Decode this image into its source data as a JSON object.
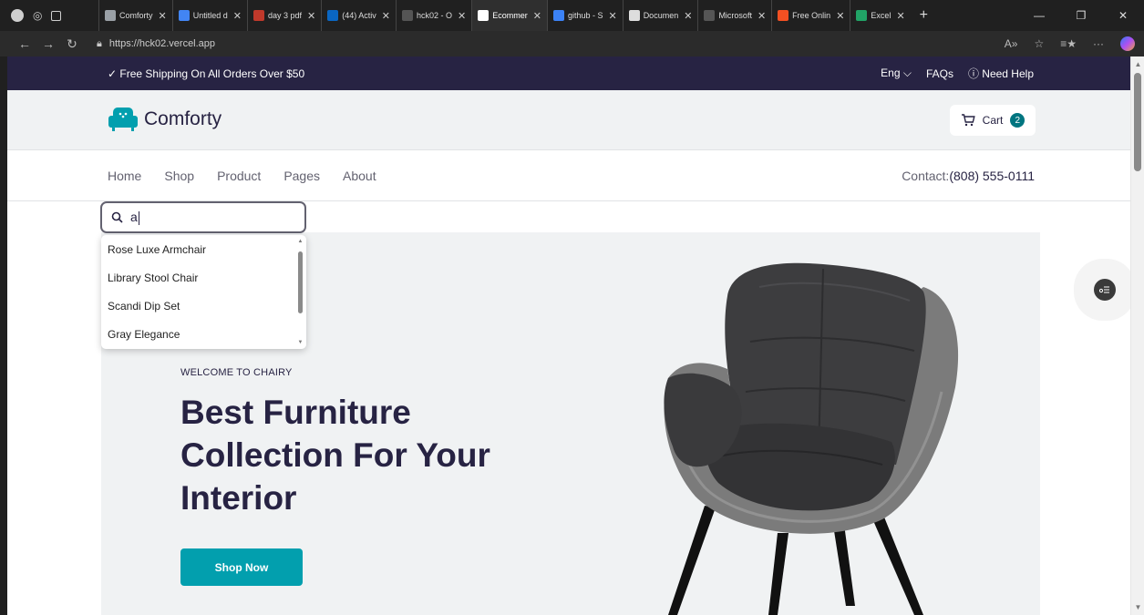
{
  "browser": {
    "tabs": [
      {
        "label": "Comforty",
        "color": "#9aa0a6"
      },
      {
        "label": "Untitled d",
        "color": "#4285f4"
      },
      {
        "label": "day 3 pdf",
        "color": "#c0392b"
      },
      {
        "label": "(44) Activ",
        "color": "#0a66c2"
      },
      {
        "label": "hck02 - O",
        "color": "#555555"
      },
      {
        "label": "Ecommer",
        "color": "#ffffff",
        "active": true
      },
      {
        "label": "github - S",
        "color": "#3b82f6"
      },
      {
        "label": "Documen",
        "color": "#dddddd"
      },
      {
        "label": "Microsoft",
        "color": "#555555"
      },
      {
        "label": "Free Onlin",
        "color": "#f25022"
      },
      {
        "label": "Excel",
        "color": "#21a366"
      }
    ],
    "url": "https://hck02.vercel.app"
  },
  "topbar": {
    "shipping": "✓ Free Shipping On All Orders Over $50",
    "lang": "Eng ⌵",
    "faqs": "FAQs",
    "help": "ⓘ Need Help"
  },
  "brand": {
    "name": "Comforty",
    "cart_label": "Cart",
    "cart_count": "2"
  },
  "nav": {
    "items": [
      "Home",
      "Shop",
      "Product",
      "Pages",
      "About"
    ],
    "contact_label": "Contact:",
    "contact_phone": "(808) 555-0111"
  },
  "search": {
    "value": "a",
    "suggestions": [
      "Rose Luxe Armchair",
      "Library Stool Chair",
      "Scandi Dip Set",
      "Gray Elegance"
    ]
  },
  "hero": {
    "eyebrow": "WELCOME TO CHAIRY",
    "headline": "Best Furniture Collection For Your Interior",
    "cta": "Shop Now"
  },
  "colors": {
    "primary": "#272343",
    "accent": "#029fae",
    "badge": "#007580"
  }
}
